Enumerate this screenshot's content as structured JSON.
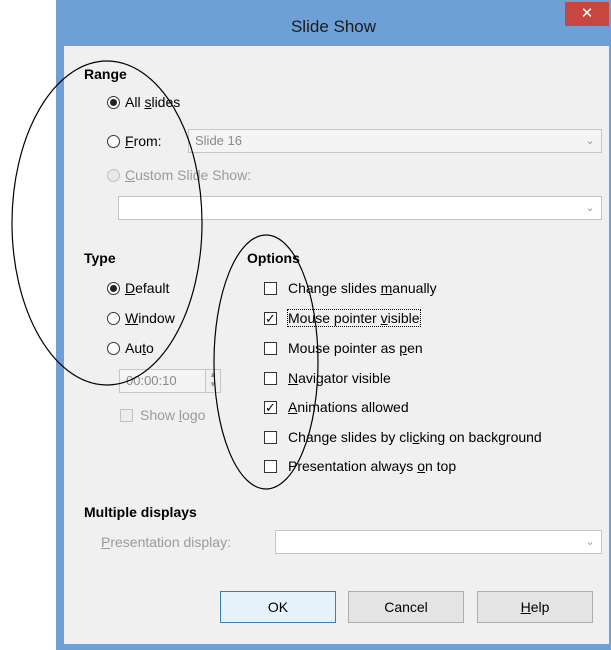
{
  "window": {
    "title": "Slide Show",
    "close_glyph": "✕"
  },
  "range": {
    "heading": "Range",
    "all_slides": {
      "pre": "All ",
      "accel": "s",
      "post": "lides",
      "selected": true
    },
    "from": {
      "pre": "",
      "accel": "F",
      "post": "rom:",
      "selected": false,
      "value": "Slide 16"
    },
    "custom": {
      "pre": "",
      "accel": "C",
      "post": "ustom Slide Show:",
      "selected": false,
      "disabled": true,
      "value": ""
    }
  },
  "type": {
    "heading": "Type",
    "default": {
      "pre": "",
      "accel": "D",
      "post": "efault",
      "selected": true
    },
    "window": {
      "pre": "",
      "accel": "W",
      "post": "indow",
      "selected": false
    },
    "auto": {
      "pre": "Au",
      "accel": "t",
      "post": "o",
      "selected": false
    },
    "duration": "00:00:10",
    "show_logo": {
      "pre": "Show ",
      "accel": "l",
      "post": "ogo",
      "checked": false,
      "disabled": true
    }
  },
  "options": {
    "heading": "Options",
    "items": [
      {
        "pre": "Change slides ",
        "accel": "m",
        "post": "anually",
        "checked": false
      },
      {
        "pre": "Mouse pointer ",
        "accel": "v",
        "post": "isible",
        "checked": true
      },
      {
        "pre": "Mouse pointer as ",
        "accel": "p",
        "post": "en",
        "checked": false
      },
      {
        "pre": "",
        "accel": "N",
        "post": "avigator visible",
        "checked": false
      },
      {
        "pre": "",
        "accel": "A",
        "post": "nimations allowed",
        "checked": true
      },
      {
        "pre": "Change slides by cli",
        "accel": "c",
        "post": "king on background",
        "checked": false
      },
      {
        "pre": "Presentation always ",
        "accel": "o",
        "post": "n top",
        "checked": false
      }
    ]
  },
  "multiple_displays": {
    "heading": "Multiple displays",
    "label": {
      "pre": "",
      "accel": "P",
      "post": "resentation display:"
    },
    "value": ""
  },
  "buttons": {
    "ok": "OK",
    "cancel": "Cancel",
    "help": {
      "pre": "",
      "accel": "H",
      "post": "elp"
    }
  },
  "icons": {
    "check_glyph": "✓",
    "dropdown_glyph": "⌄",
    "spin_up": "▲",
    "spin_down": "▼"
  }
}
